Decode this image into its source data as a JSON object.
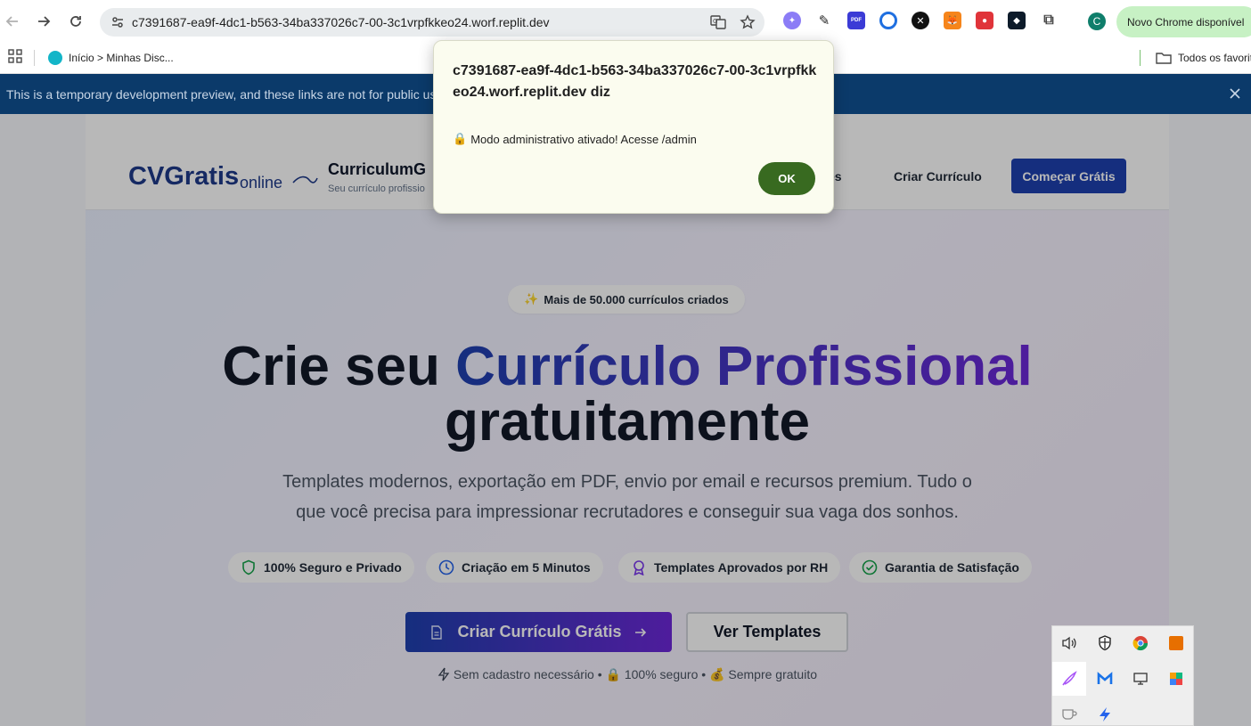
{
  "browser": {
    "url": "c7391687-ea9f-4dc1-b563-34ba337026c7-00-3c1vrpfkkeo24.worf.replit.dev",
    "update_chip": "Novo Chrome disponível",
    "profile_initial": "C",
    "bookmarks": {
      "item_label": "Início > Minhas Disc...",
      "folder_label": "Todos os favoritos"
    }
  },
  "banner": {
    "text": "This is a temporary development preview, and these links are not for public us"
  },
  "site": {
    "logo_main": "CVGratis",
    "logo_sub": "online",
    "brand_name": "CurriculumG",
    "brand_tagline": "Seu currículo profissio",
    "nav": [
      "es",
      "Criar Currículo"
    ],
    "cta_top": "Começar Grátis",
    "badge_emoji": "✨",
    "badge": "Mais de 50.000 currículos criados",
    "hero_plain": "Crie seu ",
    "hero_highlight": "Currículo Profissional",
    "hero_line2": "gratuitamente",
    "lead": "Templates modernos, exportação em PDF, envio por email e recursos premium. Tudo o que você precisa para impressionar recrutadores e conseguir sua vaga dos sonhos.",
    "features": [
      "100% Seguro e Privado",
      "Criação em 5 Minutos",
      "Templates Aprovados por RH",
      "Garantia de Satisfação"
    ],
    "cta_main": "Criar Currículo Grátis",
    "cta_secondary": "Ver Templates",
    "footnote_1": "Sem cadastro necessário",
    "footnote_2": "100% seguro",
    "footnote_3": "Sempre gratuito",
    "footnote_sep": "•"
  },
  "dialog": {
    "title": "c7391687-ea9f-4dc1-b563-34ba337026c7-00-3c1vrpfkkeo24.worf.replit.dev diz",
    "message_emoji": "🔒",
    "message": "Modo administrativo ativado! Acesse /admin",
    "ok_label": "OK"
  },
  "colors": {
    "brand": "#1e40af",
    "accent": "#6d28d9",
    "dialog_button": "#386a20",
    "banner": "#0b3a6a"
  }
}
